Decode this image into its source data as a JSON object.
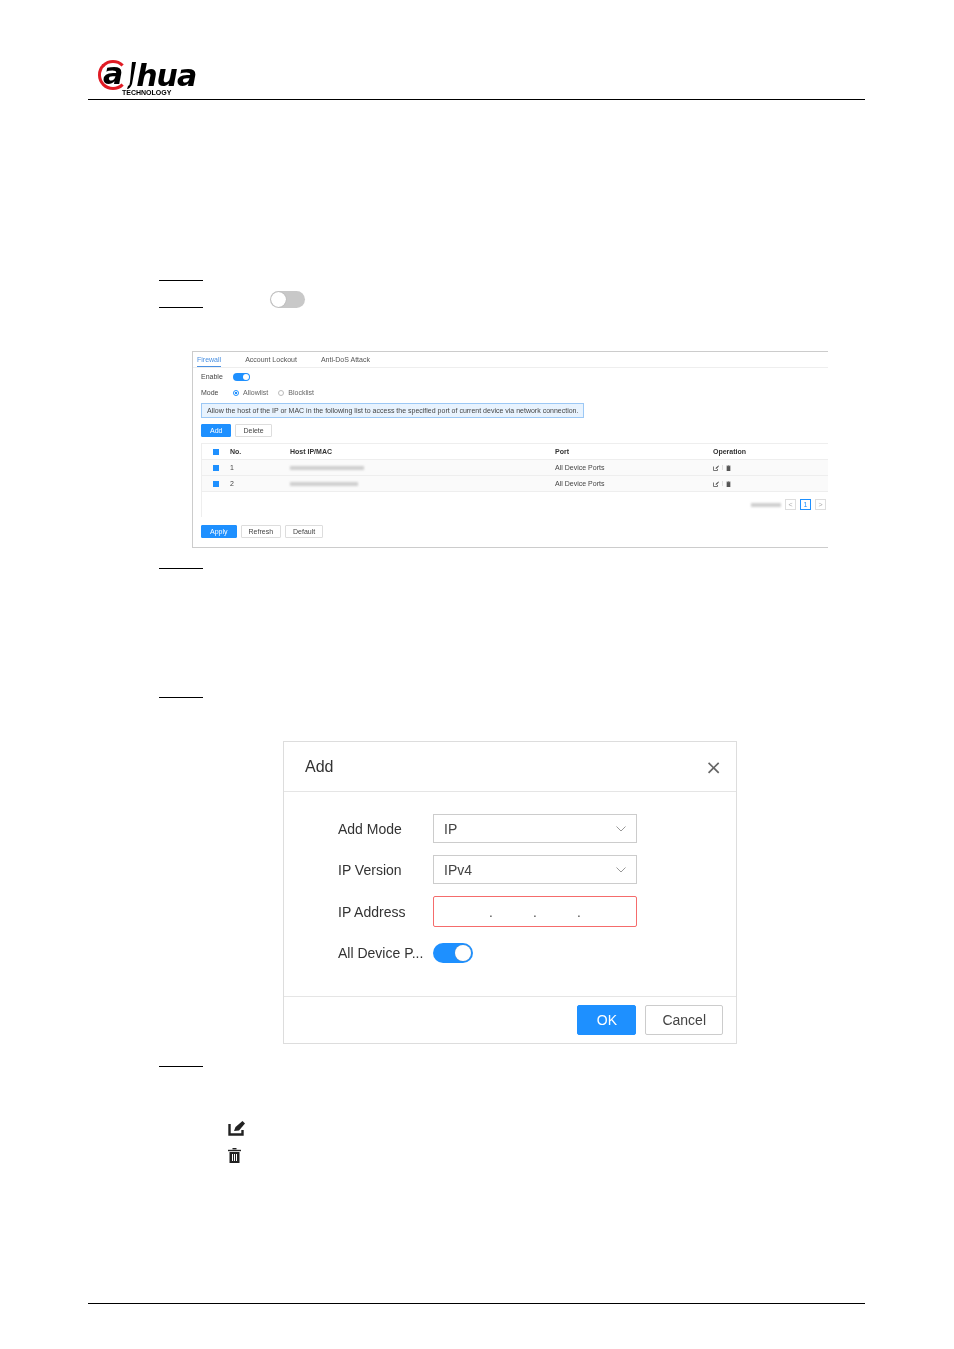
{
  "logo": {
    "mark": "a",
    "name": "hua",
    "tagline": "TECHNOLOGY"
  },
  "step_switch": {
    "on": false
  },
  "firewall_screenshot": {
    "tabs": [
      {
        "label": "Firewall",
        "selected": true
      },
      {
        "label": "Account Lockout",
        "selected": false
      },
      {
        "label": "Anti-DoS Attack",
        "selected": false
      }
    ],
    "enable": {
      "label": "Enable",
      "on": true
    },
    "mode": {
      "label": "Mode",
      "options": [
        {
          "label": "Allowlist",
          "selected": true
        },
        {
          "label": "Blocklist",
          "selected": false
        }
      ]
    },
    "notice": "Allow the host of the IP or MAC in the following list to access the specified port of current device via network connection.",
    "toolbar": [
      {
        "label": "Add",
        "kind": "primary"
      },
      {
        "label": "Delete",
        "kind": "default"
      }
    ],
    "table": {
      "all_checked": true,
      "columns": [
        "No.",
        "Host IP/MAC",
        "Port",
        "Operation"
      ],
      "rows": [
        {
          "checked": true,
          "no": "1",
          "port": "All Device Ports"
        },
        {
          "checked": true,
          "no": "2",
          "port": "All Device Ports"
        }
      ]
    },
    "pagination": {
      "prev": "<",
      "pages": [
        {
          "label": "1",
          "selected": true
        }
      ],
      "next": ">"
    },
    "buttons": [
      {
        "label": "Apply",
        "kind": "primary"
      },
      {
        "label": "Refresh",
        "kind": "default"
      },
      {
        "label": "Default",
        "kind": "default"
      }
    ]
  },
  "dialog": {
    "title": "Add",
    "close": "×",
    "fields": [
      {
        "kind": "select",
        "label": "Add Mode",
        "value": "IP"
      },
      {
        "kind": "select",
        "label": "IP Version",
        "value": "IPv4"
      },
      {
        "kind": "ip",
        "label": "IP Address",
        "invalid": true,
        "separators": [
          ".",
          ".",
          "."
        ]
      },
      {
        "kind": "switch",
        "label": "All Device P...",
        "on": true
      }
    ],
    "buttons": [
      {
        "label": "OK",
        "kind": "primary"
      },
      {
        "label": "Cancel",
        "kind": "default"
      }
    ]
  }
}
